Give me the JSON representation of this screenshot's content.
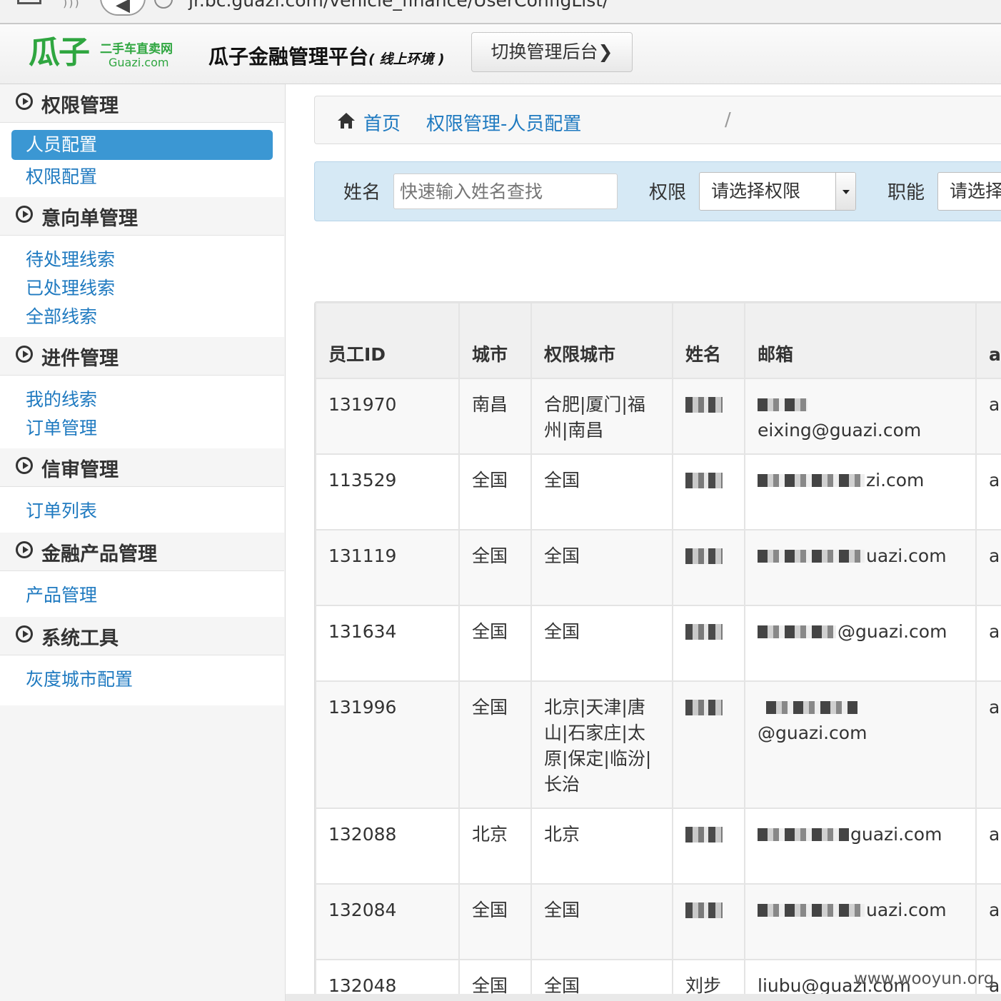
{
  "browser": {
    "url": "jr.bc.guazi.com/vehicle_finance/UserConfigList/"
  },
  "header": {
    "logo_mark": "瓜子",
    "logo_tagline": "二手车直卖网",
    "logo_domain": "Guazi.com",
    "title": "瓜子金融管理平台",
    "env": "( 线上环境 )",
    "switch_label": "切换管理后台"
  },
  "sidebar": {
    "sections": [
      {
        "label": "权限管理",
        "items": [
          "人员配置",
          "权限配置"
        ]
      },
      {
        "label": "意向单管理",
        "items": [
          "待处理线索",
          "已处理线索",
          "全部线索"
        ]
      },
      {
        "label": "进件管理",
        "items": [
          "我的线索",
          "订单管理"
        ]
      },
      {
        "label": "信审管理",
        "items": [
          "订单列表"
        ]
      },
      {
        "label": "金融产品管理",
        "items": [
          "产品管理"
        ]
      },
      {
        "label": "系统工具",
        "items": [
          "灰度城市配置"
        ]
      }
    ],
    "active_item": "人员配置"
  },
  "breadcrumb": {
    "home": "首页",
    "current": "权限管理-人员配置"
  },
  "filter": {
    "name_label": "姓名",
    "name_placeholder": "快速输入姓名查找",
    "perm_label": "权限",
    "perm_selected": "请选择权限",
    "role_label": "职能",
    "role_selected": "请选择"
  },
  "table": {
    "columns": [
      "员工ID",
      "城市",
      "权限城市",
      "姓名",
      "邮箱",
      "ap 态"
    ],
    "rows": [
      {
        "id": "131970",
        "city": "南昌",
        "perm_cities": "合肥|厦门|福州|南昌",
        "name": "",
        "email_suffix": "eixing@guazi.com",
        "last": "ap"
      },
      {
        "id": "113529",
        "city": "全国",
        "perm_cities": "全国",
        "name": "",
        "email_suffix": "zi.com",
        "last": "ap"
      },
      {
        "id": "131119",
        "city": "全国",
        "perm_cities": "全国",
        "name": "",
        "email_suffix": "uazi.com",
        "last": "ap"
      },
      {
        "id": "131634",
        "city": "全国",
        "perm_cities": "全国",
        "name": "",
        "email_suffix": "@guazi.com",
        "last": "ap"
      },
      {
        "id": "131996",
        "city": "全国",
        "perm_cities": "北京|天津|唐山|石家庄|太原|保定|临汾|长治",
        "name": "",
        "email_suffix": "@guazi.com",
        "last": "ap"
      },
      {
        "id": "132088",
        "city": "北京",
        "perm_cities": "北京",
        "name": "",
        "email_suffix": "guazi.com",
        "last": "ap"
      },
      {
        "id": "132084",
        "city": "全国",
        "perm_cities": "全国",
        "name": "",
        "email_suffix": "uazi.com",
        "last": "ap"
      },
      {
        "id": "132048",
        "city": "全国",
        "perm_cities": "全国",
        "name": "刘步",
        "email_suffix": "liubu@guazi.com",
        "last": "ap"
      }
    ]
  },
  "watermark": "www.wooyun.org"
}
